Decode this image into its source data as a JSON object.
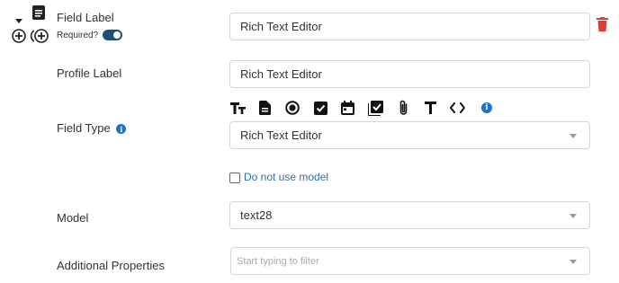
{
  "field": {
    "label": "Field Label",
    "required_label": "Required?",
    "required": true
  },
  "profile": {
    "label": "Profile Label"
  },
  "field_type": {
    "label": "Field Type"
  },
  "model": {
    "label": "Model"
  },
  "additional": {
    "label": "Additional Properties"
  },
  "inputs": {
    "field_label_value": "Rich Text Editor",
    "profile_label_value": "Rich Text Editor",
    "field_type_value": "Rich Text Editor",
    "model_value": "text28",
    "additional_placeholder": "Start typing to filter"
  },
  "options": {
    "do_not_use_model_label": "Do not use model",
    "do_not_use_model_checked": false
  },
  "toolbar_icons": [
    "text-size-icon",
    "document-icon",
    "radio-icon",
    "checkbox-icon",
    "calendar-icon",
    "checklist-icon",
    "paperclip-icon",
    "text-icon",
    "code-icon",
    "info-icon"
  ],
  "colors": {
    "delete": "#e53935",
    "info": "#1a73c9",
    "toggle": "#1f4e79",
    "link_text": "#2f6fb3"
  }
}
